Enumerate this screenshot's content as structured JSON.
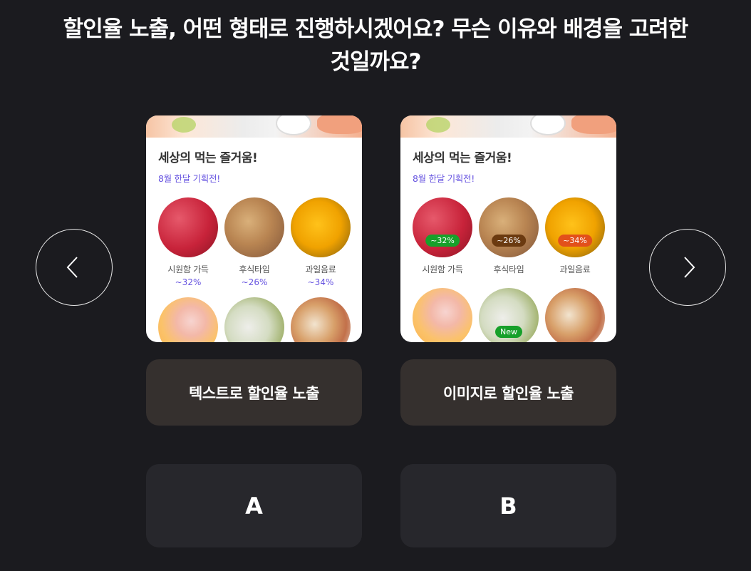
{
  "question": {
    "line1": "할인율 노출, 어떤 형태로 진행하시겠어요? 무슨 이유와 배경을 고려한",
    "line2": "것일까요?"
  },
  "card": {
    "headline": "세상의 먹는 즐거움!",
    "subline": "8월 한달 기획전!"
  },
  "items": [
    {
      "label": "시원함 가득",
      "discount": "~32%"
    },
    {
      "label": "후식타임",
      "discount": "~26%"
    },
    {
      "label": "과일음료",
      "discount": "~34%"
    }
  ],
  "badges": {
    "melon": "~32%",
    "bread": "~26%",
    "juice": "~34%",
    "bottle": "New"
  },
  "badge_colors": {
    "green": "#17a02a",
    "brown": "#6b3a10",
    "orange": "#e2501b"
  },
  "options": {
    "a_label": "텍스트로 할인율 노출",
    "b_label": "이미지로 할인율 노출"
  },
  "choices": {
    "a": "A",
    "b": "B"
  },
  "icons": {
    "prev": "chevron-left-icon",
    "next": "chevron-right-icon"
  },
  "colors": {
    "background": "#1b1b1f",
    "accent_purple": "#6653e0",
    "option_button": "#35302e",
    "choice_button": "#27272c"
  }
}
